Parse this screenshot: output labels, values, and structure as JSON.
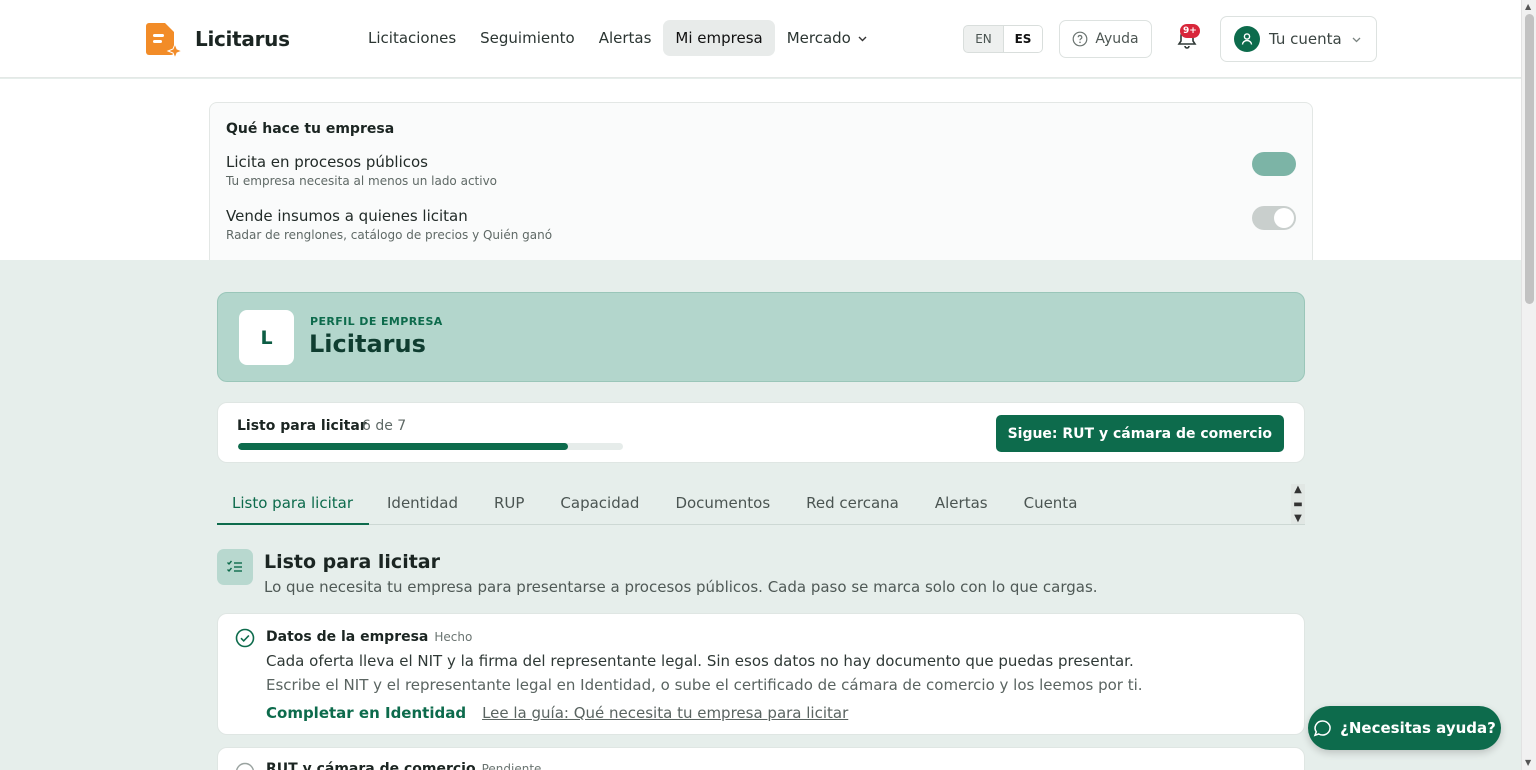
{
  "header": {
    "brand": "Licitarus",
    "nav": [
      {
        "label": "Licitaciones"
      },
      {
        "label": "Seguimiento"
      },
      {
        "label": "Alertas"
      },
      {
        "label": "Mi empresa"
      },
      {
        "label": "Mercado"
      }
    ],
    "lang_en": "EN",
    "lang_es": "ES",
    "help_label": "Ayuda",
    "notif_badge": "9+",
    "account_label": "Tu cuenta"
  },
  "what": {
    "title": "Qué hace tu empresa",
    "row1_title": "Licita en procesos públicos",
    "row1_sub": "Tu empresa necesita al menos un lado activo",
    "row1_on": true,
    "row2_title": "Vende insumos a quienes licitan",
    "row2_sub": "Radar de renglones, catálogo de precios y Quién ganó",
    "row2_on": false
  },
  "profile": {
    "initial": "L",
    "kicker": "PERFIL DE EMPRESA",
    "name": "Licitarus"
  },
  "ready": {
    "label": "Listo para licitar",
    "count": "6 de 7",
    "progress_fraction": 0.857,
    "next_button": "Sigue: RUT y cámara de comercio"
  },
  "tabs": [
    {
      "label": "Listo para licitar"
    },
    {
      "label": "Identidad"
    },
    {
      "label": "RUP"
    },
    {
      "label": "Capacidad"
    },
    {
      "label": "Documentos"
    },
    {
      "label": "Red cercana"
    },
    {
      "label": "Alertas"
    },
    {
      "label": "Cuenta"
    }
  ],
  "section": {
    "title": "Listo para licitar",
    "desc": "Lo que necesita tu empresa para presentarse a procesos públicos. Cada paso se marca solo con lo que cargas."
  },
  "steps": [
    {
      "title": "Datos de la empresa",
      "status": "Hecho",
      "line1": "Cada oferta lleva el NIT y la firma del representante legal. Sin esos datos no hay documento que puedas presentar.",
      "line2": "Escribe el NIT y el representante legal en Identidad, o sube el certificado de cámara de comercio y los leemos por ti.",
      "action": "Completar en Identidad",
      "link": "Lee la guía: Qué necesita tu empresa para licitar"
    },
    {
      "title": "RUT y cámara de comercio",
      "status": "Pendiente"
    }
  ],
  "chat_label": "¿Necesitas ayuda?",
  "colors": {
    "brand": "#0d6b4c",
    "logo_orange": "#f28c28",
    "badge_red": "#d8263a"
  }
}
